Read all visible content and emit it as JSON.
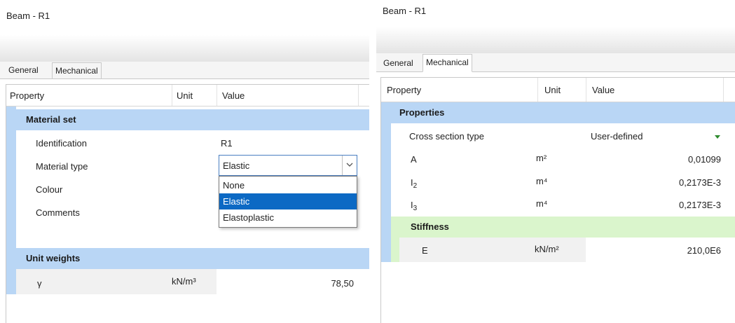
{
  "left": {
    "title": "Beam - R1",
    "tabs": [
      {
        "label": "General",
        "active": true
      },
      {
        "label": "Mechanical",
        "active": false
      }
    ],
    "columns": {
      "property": "Property",
      "unit": "Unit",
      "value": "Value"
    },
    "sections": {
      "material_set": "Material set",
      "unit_weights": "Unit weights"
    },
    "rows": {
      "identification": {
        "label": "Identification",
        "value": "R1"
      },
      "material_type": {
        "label": "Material type",
        "value": "Elastic"
      },
      "colour": {
        "label": "Colour"
      },
      "comments": {
        "label": "Comments"
      },
      "gamma": {
        "label": "γ",
        "unit": "kN/m³",
        "value": "78,50"
      }
    },
    "dropdown_options": [
      "None",
      "Elastic",
      "Elastoplastic"
    ],
    "dropdown_selected": "Elastic"
  },
  "right": {
    "title": "Beam - R1",
    "tabs": [
      {
        "label": "General",
        "active": false
      },
      {
        "label": "Mechanical",
        "active": true
      }
    ],
    "columns": {
      "property": "Property",
      "unit": "Unit",
      "value": "Value"
    },
    "sections": {
      "properties": "Properties",
      "stiffness": "Stiffness"
    },
    "rows": {
      "cross_section": {
        "label": "Cross section type",
        "value": "User-defined"
      },
      "A": {
        "label": "A",
        "unit": "m²",
        "value": "0,01099"
      },
      "I2": {
        "label": "I",
        "sub": "2",
        "unit": "m⁴",
        "value": "0,2173E-3"
      },
      "I3": {
        "label": "I",
        "sub": "3",
        "unit": "m⁴",
        "value": "0,2173E-3"
      },
      "E": {
        "label": "E",
        "unit": "kN/m²",
        "value": "210,0E6"
      }
    }
  },
  "colors": {
    "section_blue": "#b9d6f5",
    "section_green": "#daf5cc",
    "selected_option": "#0c69c4",
    "dropdown_caret": "#2e8b2e"
  },
  "icons": {
    "combo_arrow": "chevron-down-icon",
    "cross_section_caret": "caret-down-icon"
  }
}
